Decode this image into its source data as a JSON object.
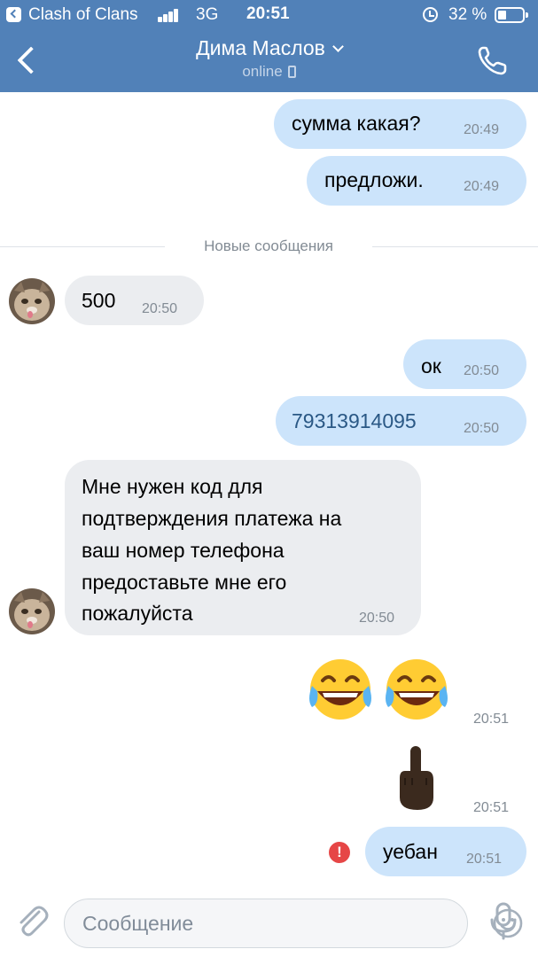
{
  "status_bar": {
    "app_name": "Clash of Clans",
    "network": "3G",
    "time": "20:51",
    "battery": "32 %"
  },
  "header": {
    "title": "Дима Маслов",
    "subtitle": "online"
  },
  "messages": {
    "m1": {
      "text": "сумма какая?",
      "time": "20:49"
    },
    "m2": {
      "text": "предложи.",
      "time": "20:49"
    },
    "divider": "Новые сообщения",
    "m3": {
      "text": "500",
      "time": "20:50"
    },
    "m4": {
      "text": "ок",
      "time": "20:50"
    },
    "m5": {
      "text": "79313914095",
      "time": "20:50"
    },
    "m6": {
      "lines": [
        "Мне нужен код для",
        "подтверждения платежа на",
        "ваш номер телефона",
        "предоставьте мне его",
        "пожалуйста"
      ],
      "time": "20:50"
    },
    "m7": {
      "text": "😂😂",
      "time": "20:51"
    },
    "m8": {
      "text": "🖕🏿",
      "time": "20:51"
    },
    "m9": {
      "text": "уебан",
      "time": "20:51",
      "error_mark": "!"
    }
  },
  "composer": {
    "placeholder": "Сообщение"
  },
  "colors": {
    "header": "#5181b8",
    "outgoing_bubble": "#cce4fb",
    "incoming_bubble": "#ebedf0",
    "link": "#2a5885",
    "error": "#e64646"
  }
}
